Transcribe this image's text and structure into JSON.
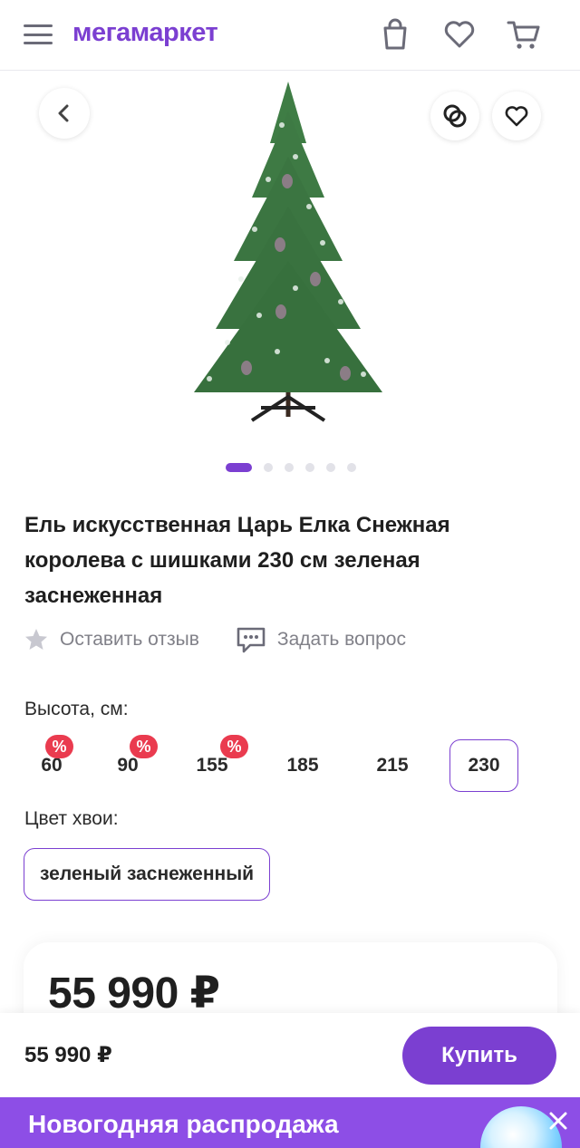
{
  "header": {
    "logo": "мегамаркет",
    "icons": [
      "menu-icon",
      "bag-icon",
      "heart-icon",
      "cart-icon"
    ]
  },
  "gallery": {
    "current_slide": 1,
    "slides_total": 6,
    "icons": [
      "back-icon",
      "compare-icon",
      "favorite-icon"
    ]
  },
  "product": {
    "title": "Ель искусственная Царь Елка Снежная королева с шишками 230 см зеленая заснеженная",
    "review_label": "Оставить отзыв",
    "question_label": "Задать вопрос"
  },
  "height": {
    "label": "Высота, см:",
    "options": [
      {
        "value": "60",
        "badge": "%"
      },
      {
        "value": "90",
        "badge": "%"
      },
      {
        "value": "155",
        "badge": "%"
      },
      {
        "value": "185"
      },
      {
        "value": "215"
      },
      {
        "value": "230",
        "selected": true
      }
    ]
  },
  "needle_color": {
    "label": "Цвет хвои:",
    "selected": "зеленый заснеженный"
  },
  "price": {
    "main": "55 990 ₽",
    "bar": "55 990 ₽",
    "buy_label": "Купить"
  },
  "promo": {
    "text": "Новогодняя распродажа"
  },
  "colors": {
    "accent": "#7b3fd1",
    "discount_badge": "#ea3b4f",
    "promo_bg": "#8d4ee6"
  }
}
